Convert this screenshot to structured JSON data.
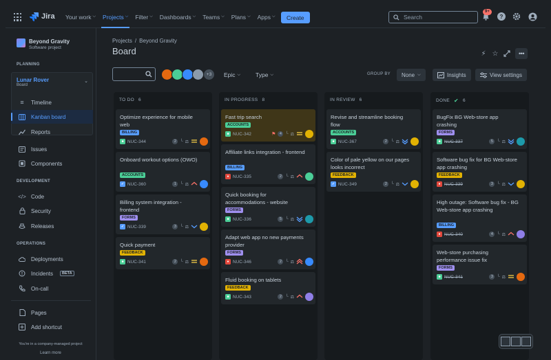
{
  "nav": {
    "app_name": "Jira",
    "items": [
      {
        "label": "Your work",
        "active": false
      },
      {
        "label": "Projects",
        "active": true
      },
      {
        "label": "Filter",
        "active": false
      },
      {
        "label": "Dashboards",
        "active": false
      },
      {
        "label": "Teams",
        "active": false
      },
      {
        "label": "Plans",
        "active": false
      },
      {
        "label": "Apps",
        "active": false
      }
    ],
    "create_label": "Create",
    "search_placeholder": "Search",
    "notifications_badge": "9+"
  },
  "sidebar": {
    "project_name": "Beyond Gravity",
    "project_type": "Software project",
    "planning_label": "PLANNING",
    "board_name": "Lunar Rover",
    "board_type": "Board",
    "planning_items": [
      "Timeline",
      "Kanban board",
      "Reports"
    ],
    "other_items": [
      "Issues",
      "Components"
    ],
    "development_label": "DEVELOPMENT",
    "development_items": [
      "Code",
      "Security",
      "Releases"
    ],
    "operations_label": "OPERATIONS",
    "operations_items": [
      "Deployments",
      "Incidents",
      "On-call"
    ],
    "beta_label": "BETA",
    "footer_items": [
      "Pages",
      "Add shortcut"
    ],
    "footer_note": "You're in a company-managed project",
    "learn_more": "Learn more"
  },
  "header": {
    "breadcrumb": [
      "Projects",
      "Beyond Gravity"
    ],
    "title": "Board"
  },
  "toolbar": {
    "avatars_more": "+3",
    "epic_label": "Epic",
    "type_label": "Type",
    "group_by_label": "GROUP BY",
    "group_by_value": "None",
    "insights_label": "Insights",
    "view_settings_label": "View settings"
  },
  "columns": [
    {
      "name": "TO DO",
      "count": "6",
      "cards": [
        {
          "title": "Optimize experience for mobile web",
          "tag": "BILLING",
          "tag_type": "billing",
          "key": "NUC-344",
          "issue_type": "story",
          "estimate": "2",
          "priority": "medium",
          "done": false,
          "avatar": "#e56910"
        },
        {
          "title": "Onboard workout options (OWO)",
          "tag": "ACCOUNTS",
          "tag_type": "accounts",
          "key": "NUC-360",
          "issue_type": "task",
          "estimate": "1",
          "priority": "low-medium",
          "done": false,
          "avatar": "#388bff"
        },
        {
          "title": "Billing system integration - frontend",
          "tag": "FORMS",
          "tag_type": "forms",
          "key": "NUC-339",
          "issue_type": "task",
          "estimate": "3",
          "priority": "low",
          "done": false,
          "avatar": "#e2b203"
        },
        {
          "title": "Quick payment",
          "tag": "FEEDBACK",
          "tag_type": "feedback",
          "key": "NUC-341",
          "issue_type": "story",
          "estimate": "2",
          "priority": "medium",
          "done": false,
          "avatar": "#e56910"
        }
      ]
    },
    {
      "name": "IN PROGRESS",
      "count": "8",
      "cards": [
        {
          "title": "Fast trip search",
          "tag": "ACCOUNTS",
          "tag_type": "accounts",
          "key": "NUC-342",
          "issue_type": "story",
          "estimate": "4",
          "priority": "medium",
          "done": false,
          "flag": true,
          "avatar": "#e2b203"
        },
        {
          "title": "Affiliate links integration - frontend",
          "tag": "BILLING",
          "tag_type": "billing",
          "key": "NUC-335",
          "issue_type": "bug",
          "estimate": "2",
          "priority": "high",
          "done": false,
          "avatar": "#4bce97"
        },
        {
          "title": "Quick booking for accommodations - website",
          "tag": "FORMS",
          "tag_type": "forms",
          "key": "NUC-336",
          "issue_type": "story",
          "estimate": "5",
          "priority": "lowest",
          "done": false,
          "avatar": "#1d9aaa"
        },
        {
          "title": "Adapt web app no new payments provider",
          "tag": "FORMS",
          "tag_type": "forms",
          "key": "NUC-346",
          "issue_type": "bug",
          "estimate": "2",
          "priority": "highest",
          "done": false,
          "avatar": "#388bff"
        },
        {
          "title": "Fluid booking on tablets",
          "tag": "FEEDBACK",
          "tag_type": "feedback",
          "key": "NUC-343",
          "issue_type": "story",
          "estimate": "2",
          "priority": "high",
          "done": false,
          "avatar": "#8f7ee7"
        }
      ]
    },
    {
      "name": "IN REVIEW",
      "count": "6",
      "cards": [
        {
          "title": "Revise and streamline booking flow",
          "tag": "ACCOUNTS",
          "tag_type": "accounts",
          "key": "NUC-367",
          "issue_type": "story",
          "estimate": "2",
          "priority": "lowest",
          "done": false,
          "avatar": "#e2b203"
        },
        {
          "title": "Color of pale yellow on our pages looks incorrect",
          "tag": "FEEDBACK",
          "tag_type": "feedback",
          "key": "NUC-349",
          "issue_type": "task",
          "estimate": "2",
          "priority": "low",
          "done": false,
          "avatar": "#e2b203"
        }
      ]
    },
    {
      "name": "DONE",
      "count": "6",
      "cards": [
        {
          "title": "BugFix BG Web-store app crashing",
          "tag": "FORMS",
          "tag_type": "forms",
          "key": "NUC-337",
          "issue_type": "story",
          "estimate": "5",
          "priority": "lowest",
          "done": true,
          "avatar": "#1d9aaa"
        },
        {
          "title": "Software bug fix for BG Web-store app crashing",
          "tag": "FEEDBACK",
          "tag_type": "feedback",
          "key": "NUC-339",
          "issue_type": "bug",
          "estimate": "3",
          "priority": "low",
          "done": true,
          "avatar": "#e2b203"
        },
        {
          "title": "High outage: Software bug fix - BG Web-store app crashing",
          "tag": "BILLING",
          "tag_type": "billing",
          "key": "NUC-340",
          "issue_type": "bug",
          "estimate": "4",
          "priority": "high",
          "done": true,
          "avatar": "#8f7ee7"
        },
        {
          "title": "Web-store purchasing performance issue fix",
          "tag": "FORMS",
          "tag_type": "forms",
          "key": "NUC-341",
          "issue_type": "story",
          "estimate": "3",
          "priority": "medium",
          "done": true,
          "avatar": "#e56910"
        }
      ]
    }
  ]
}
